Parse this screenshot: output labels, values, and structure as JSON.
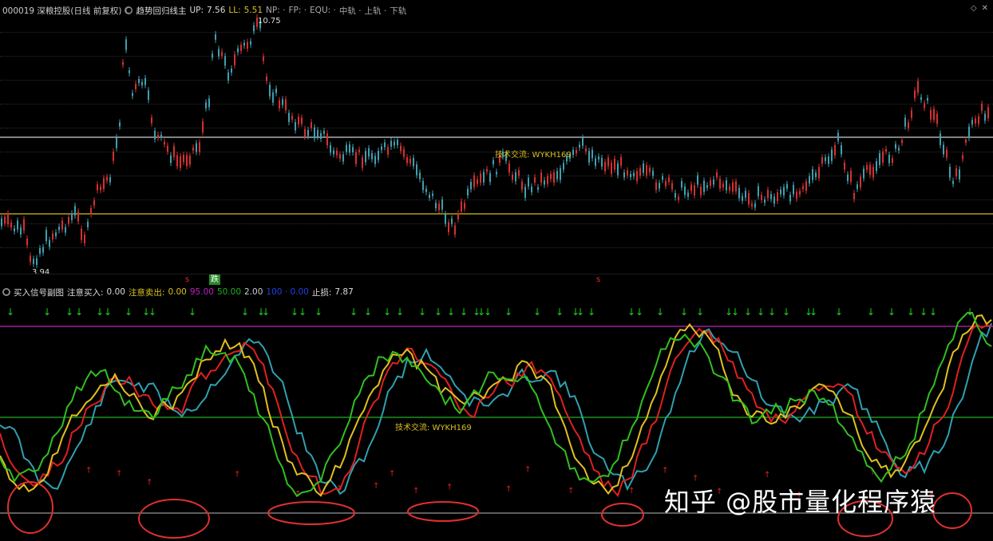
{
  "main_header": {
    "stock": "000019 深粮控股(日线 前复权)",
    "indicator": "趋势回归线主",
    "up_label": "UP:",
    "up_value": "7.56",
    "ll_label": "LL:",
    "ll_value": "5.51",
    "np_label": "NP: ·",
    "fp_label": "FP: ·",
    "equ_label": "EQU: ·",
    "mid_label": "中轨 ·",
    "upper_label": "上轨 ·",
    "lower_label": "下轨"
  },
  "main_chart": {
    "high_label": "10.75",
    "low_label": "3.94",
    "tech_text": "技术交流: WYKH169"
  },
  "markers": {
    "s": "s",
    "fall": "跌"
  },
  "ind_header": {
    "title": "买入信号副图",
    "buy_label": "注意买入:",
    "buy_value": "0.00",
    "sell_label": "注意卖出:",
    "sell_value": "0.00",
    "v95": "95.00",
    "v50": "50.00",
    "v2": "2.00",
    "v_blue": "100 · 0.00",
    "stop_label": "止损:",
    "stop_value": "7.87"
  },
  "ind_chart": {
    "tech_text": "技术交流: WYKH169"
  },
  "watermark": "知乎 @股市量化程序猿",
  "colors": {
    "candle_up": "#d83030",
    "candle_down": "#3fa0b0",
    "line_white": "#cfcfcf",
    "line_yellow": "#d8c020",
    "line_magenta": "#c020c0",
    "line_green": "#20b020",
    "osc_red": "#e02020",
    "osc_cyan": "#30a0b0",
    "osc_yellow": "#e0c020",
    "osc_green": "#30c020",
    "circle": "#e03030",
    "arrow_green": "#20d020"
  }
}
